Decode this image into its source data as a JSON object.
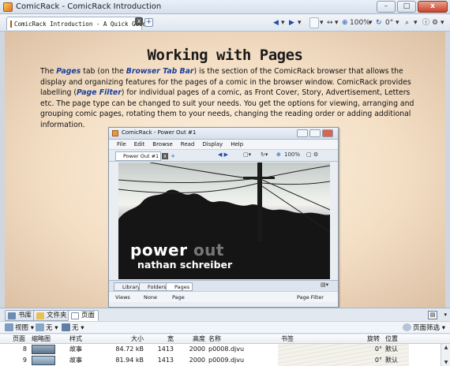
{
  "window": {
    "title": "ComicRack - ComicRack Introduction",
    "controls": {
      "minimize": "–",
      "maximize": "□",
      "close": "x"
    }
  },
  "tabbar": {
    "document_tab": "ComicRack Introduction - A Quick Guide",
    "close_glyph": "x",
    "add_glyph": "+"
  },
  "toolbar": {
    "back": "◀",
    "forward": "▶",
    "zoom": "100%",
    "rotation": "0°",
    "search_glyph": "⌕"
  },
  "content": {
    "heading": "Working with Pages",
    "paragraph": [
      {
        "text": "The "
      },
      {
        "text": "Pages",
        "em": true
      },
      {
        "text": " tab (on the "
      },
      {
        "text": "Browser Tab Bar",
        "em": true
      },
      {
        "text": ") is the section of the ComicRack browser that allows the display and organizing features for the pages of a comic in the browser window. ComicRack provides labelling ("
      },
      {
        "text": "Page Filter",
        "em": true
      },
      {
        "text": ") for individual pages of a comic, as Front Cover, Story, Advertisement, Letters etc. The page type can be changed to suit your needs. You get the  options for viewing, arranging and grouping comic pages, rotating them to your needs, changing the reading order or adding additional information."
      }
    ]
  },
  "screenshot": {
    "title": "ComicRack - Power Out #1",
    "menu": [
      "File",
      "Edit",
      "Browse",
      "Read",
      "Display",
      "Help"
    ],
    "doc_tab": "Power Out #1",
    "zoom": "100%",
    "cover": {
      "title_main": "power ",
      "title_dim": "out",
      "author": "nathan schreiber"
    },
    "browser_tabs": [
      "Library",
      "Folders",
      "Pages"
    ],
    "options": {
      "views": "Views",
      "group": "None",
      "arrange": "Page",
      "filter": "Page Filter"
    }
  },
  "bottom_pane": {
    "tabs": [
      "书库",
      "文件夹",
      "页面"
    ],
    "options": {
      "view": "视图",
      "group": "无",
      "arrange": "无",
      "filter": "页面筛选"
    },
    "columns": [
      "页面",
      "缩略图",
      "样式",
      "大小",
      "宽",
      "高度",
      "名称",
      "书签",
      "旋转",
      "位置"
    ],
    "rows": [
      {
        "page": "8",
        "type": "故事",
        "size": "84.72 kB",
        "width": "1413",
        "height": "2000",
        "name": "p0008.djvu",
        "bookmark": "",
        "rotation": "0°",
        "position": "默认"
      },
      {
        "page": "9",
        "type": "故事",
        "size": "81.94 kB",
        "width": "1413",
        "height": "2000",
        "name": "p0009.djvu",
        "bookmark": "",
        "rotation": "0°",
        "position": "默认"
      }
    ]
  },
  "colors": {
    "accent": "#1c3f9a",
    "paper": "#f4dfc5",
    "close_button": "#c8432a"
  }
}
